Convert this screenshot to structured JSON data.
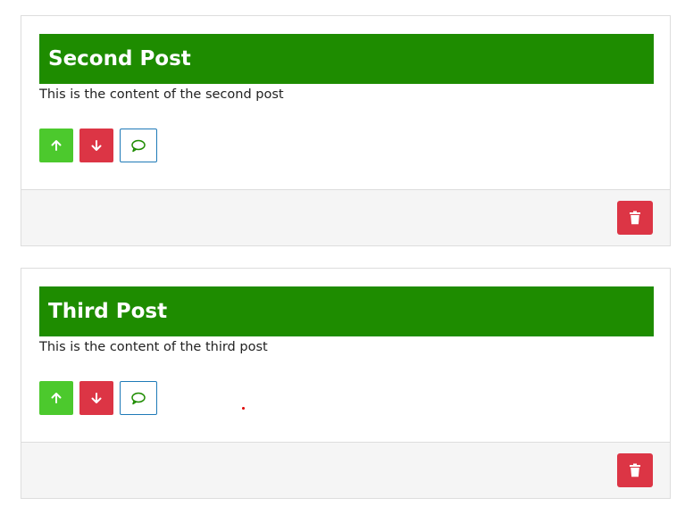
{
  "posts": [
    {
      "title": "Second Post",
      "content": "This is the content of the second post",
      "actions": {
        "upvote_icon": "arrow-up-icon",
        "downvote_icon": "arrow-down-icon",
        "comment_icon": "speech-bubble-icon",
        "delete_icon": "trash-icon"
      }
    },
    {
      "title": "Third Post",
      "content": "This is the content of the third post",
      "actions": {
        "upvote_icon": "arrow-up-icon",
        "downvote_icon": "arrow-down-icon",
        "comment_icon": "speech-bubble-icon",
        "delete_icon": "trash-icon"
      }
    }
  ],
  "colors": {
    "title_bar": "#1e8c00",
    "upvote": "#4cc92d",
    "downvote": "#dc3545",
    "comment_border": "#1f7ab8",
    "delete": "#dc3545",
    "footer_bg": "#f5f5f5"
  }
}
